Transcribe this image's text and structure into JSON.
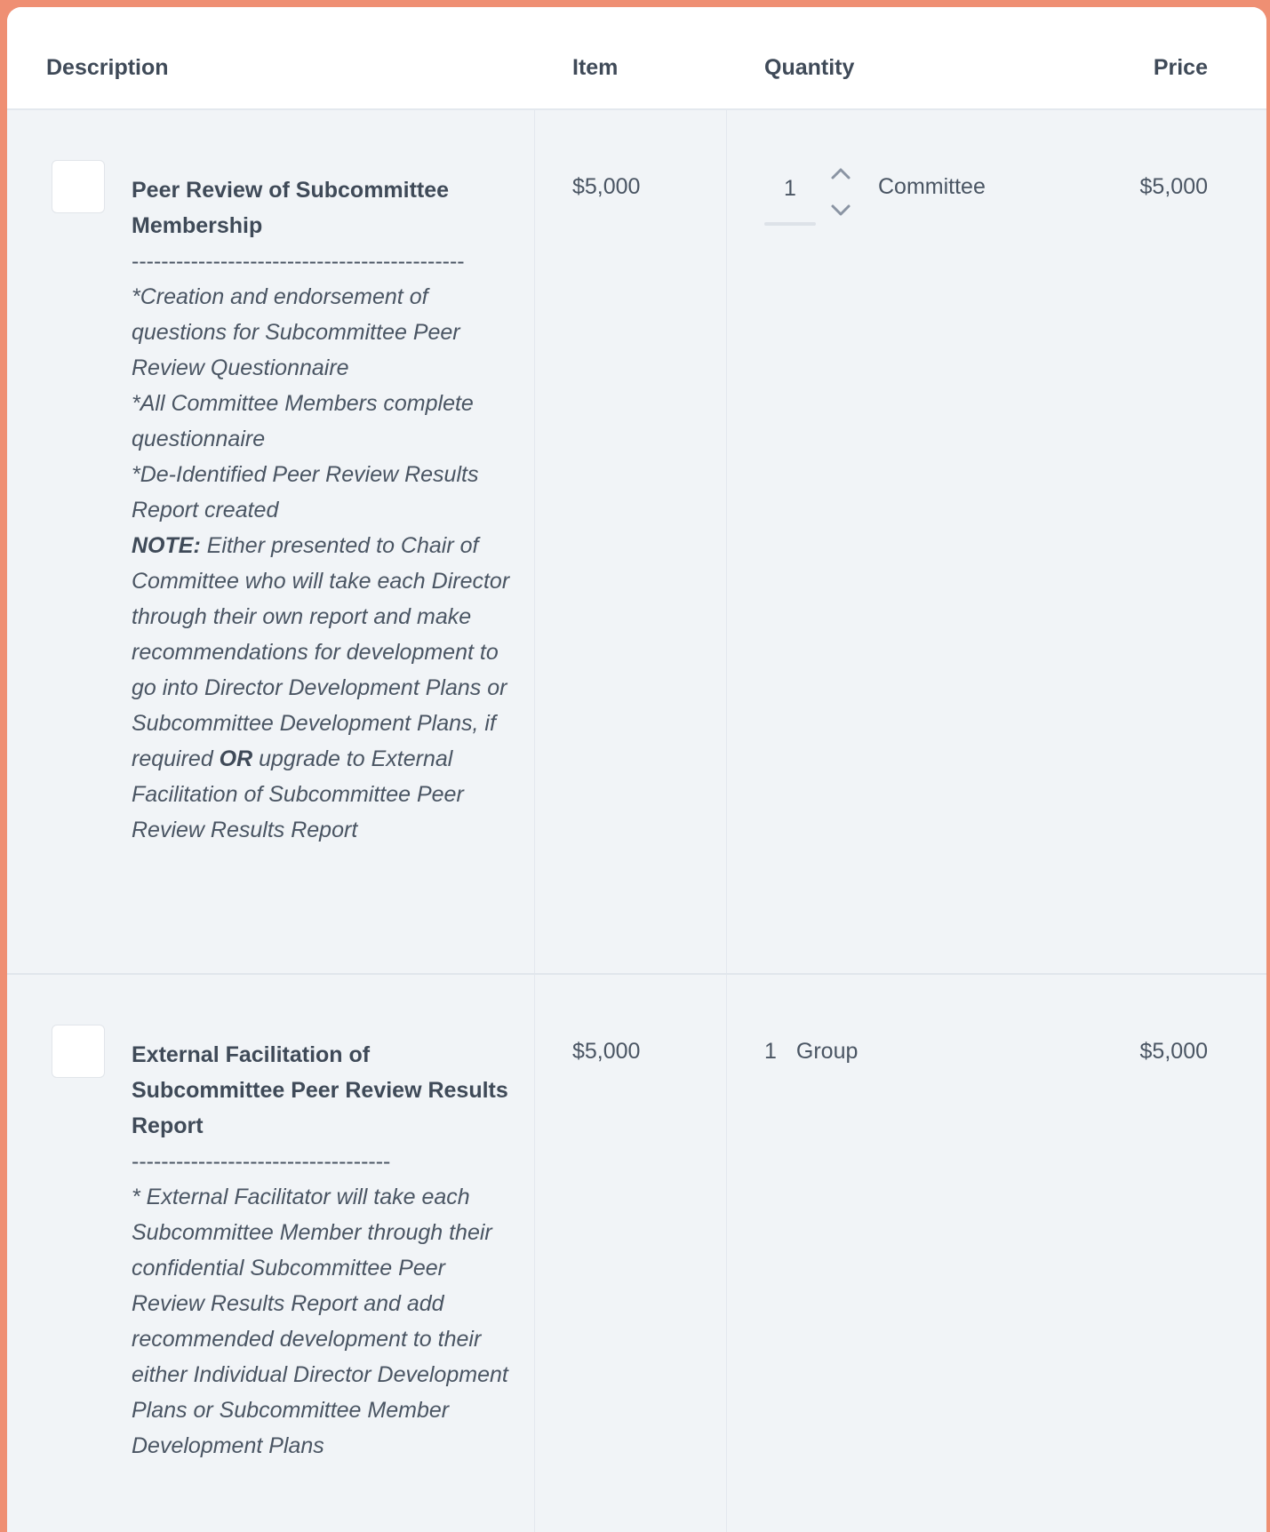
{
  "header": {
    "description": "Description",
    "item": "Item",
    "quantity": "Quantity",
    "price": "Price"
  },
  "rows": [
    {
      "title": "Peer Review of Subcommittee Membership",
      "divider": "---------------------------------------------",
      "body_lines": [
        "*Creation and endorsement of questions for  Subcommittee Peer Review Questionnaire",
        "*All Committee Members complete questionnaire",
        "*De-Identified Peer Review Results Report created"
      ],
      "note_label": "NOTE:",
      "note_text_a": " Either presented to Chair of Committee who will take each Director through their own report and make recommendations for development to go into Director Development Plans or Subcommittee Development Plans, if required ",
      "or_label": "OR",
      "note_text_b": " upgrade to External Facilitation of Subcommittee Peer Review Results Report",
      "item_price": "$5,000",
      "quantity": "1",
      "unit": "Committee",
      "price": "$5,000"
    },
    {
      "title": "External Facilitation of Subcommittee Peer Review Results Report",
      "divider": "-----------------------------------",
      "body": "* External Facilitator will take each Subcommittee Member through their confidential Subcommittee Peer Review Results Report and add recommended development to their either Individual Director Development Plans or Subcommittee Member Development Plans",
      "item_price": "$5,000",
      "quantity": "1",
      "unit": "Group",
      "price": "$5,000"
    }
  ],
  "icons": {
    "increment": "chevron-up-icon",
    "decrement": "chevron-down-icon"
  },
  "colors": {
    "frame": "#ef8f73",
    "row_bg": "#f1f4f7",
    "text": "#3f4a58"
  }
}
